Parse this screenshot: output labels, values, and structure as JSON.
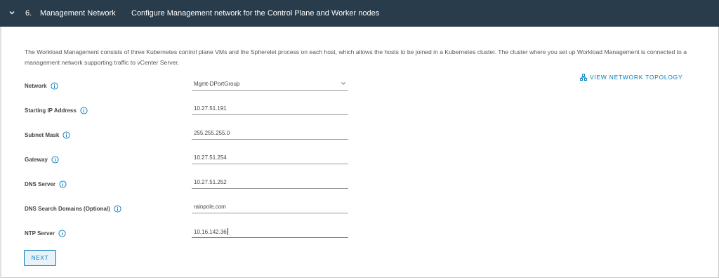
{
  "header": {
    "step_number": "6.",
    "step_title": "Management Network",
    "step_description": "Configure Management network for the Control Plane and Worker nodes"
  },
  "description": "The Workload Management consists of three Kubernetes control plane VMs and the Spherelet process on each host, which allows the hosts to be joined in a Kubernetes cluster. The cluster where you set up Workload Management is connected to a management network supporting traffic to vCenter Server.",
  "topology_link": "VIEW NETWORK TOPOLOGY",
  "form": {
    "network": {
      "label": "Network",
      "value": "Mgmt-DPortGroup"
    },
    "starting_ip": {
      "label": "Starting IP Address",
      "value": "10.27.51.191"
    },
    "subnet_mask": {
      "label": "Subnet Mask",
      "value": "255.255.255.0"
    },
    "gateway": {
      "label": "Gateway",
      "value": "10.27.51.254"
    },
    "dns_server": {
      "label": "DNS Server",
      "value": "10.27.51.252"
    },
    "dns_search": {
      "label": "DNS Search Domains (Optional)",
      "value": "rainpole.com"
    },
    "ntp_server": {
      "label": "NTP Server",
      "value": "10.16.142.36"
    }
  },
  "next_label": "NEXT",
  "colors": {
    "header_bg": "#283c4b",
    "link": "#0079b8",
    "active_underline": "#1b82c6"
  },
  "icons": {
    "collapse": "chevron-down-icon",
    "info": "info-circle-icon",
    "topology": "network-topology-icon",
    "dropdown": "chevron-down-icon"
  }
}
